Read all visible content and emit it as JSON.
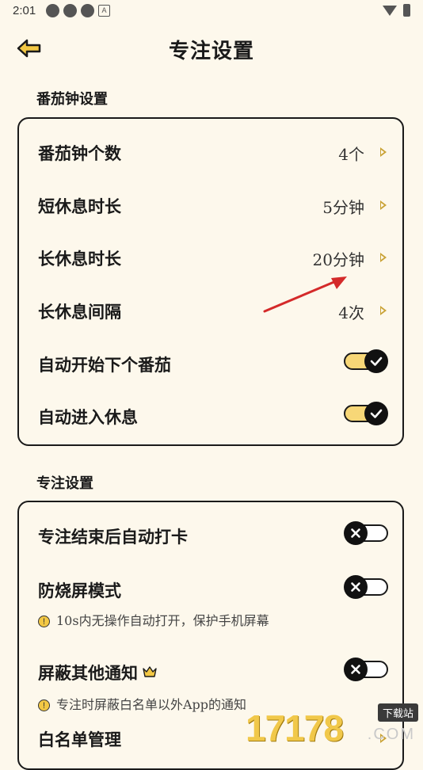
{
  "status": {
    "time": "2:01"
  },
  "page": {
    "title": "专注设置"
  },
  "pomodoro_section": {
    "label": "番茄钟设置",
    "rows": [
      {
        "label": "番茄钟个数",
        "value": "4个"
      },
      {
        "label": "短休息时长",
        "value": "5分钟"
      },
      {
        "label": "长休息时长",
        "value": "20分钟"
      },
      {
        "label": "长休息间隔",
        "value": "4次"
      }
    ],
    "toggles": [
      {
        "label": "自动开始下个番茄",
        "state": "on"
      },
      {
        "label": "自动进入休息",
        "state": "on"
      }
    ]
  },
  "focus_section": {
    "label": "专注设置",
    "items": [
      {
        "label": "专注结束后自动打卡",
        "state": "off"
      },
      {
        "label": "防烧屏模式",
        "state": "off",
        "hint": "10s内无操作自动打开，保护手机屏幕"
      },
      {
        "label": "屏蔽其他通知",
        "state": "off",
        "hint": "专注时屏蔽白名单以外App的通知"
      },
      {
        "label": "白名单管理"
      }
    ]
  },
  "colors": {
    "accent": "#f7d777",
    "background": "#fdf8ec",
    "arrow": "#d42a2a"
  },
  "watermark": {
    "text": "17178",
    "badge": "下载站",
    "suffix": ".COM"
  }
}
